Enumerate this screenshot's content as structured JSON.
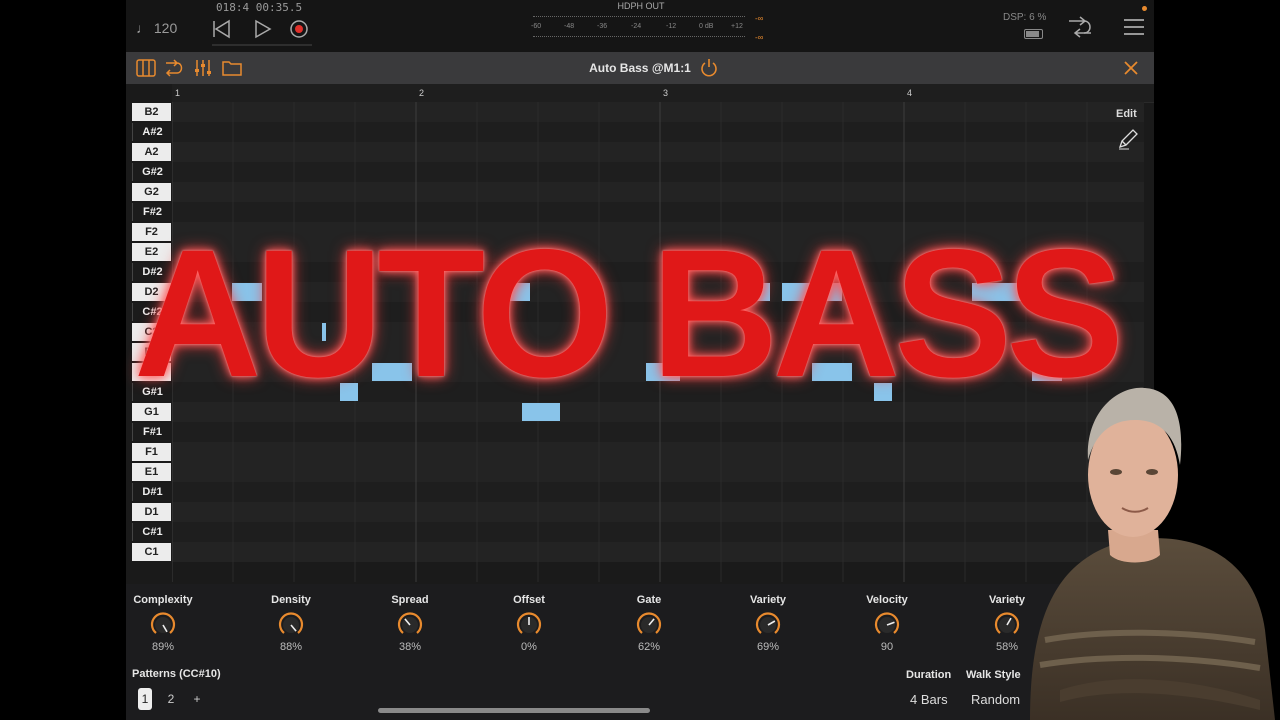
{
  "transport": {
    "tempo": "♩ 120",
    "position": "018:4   00:35.5",
    "meter_label": "HDPH OUT",
    "meter_ticks": [
      "-60",
      "-48",
      "-36",
      "-24",
      "-12",
      "0 dB",
      "+12"
    ],
    "meter_peak": "-∞",
    "dsp": "DSP: 6 %"
  },
  "plugin": {
    "title": "Auto Bass @M1:1"
  },
  "ruler": [
    "1",
    "2",
    "3",
    "4"
  ],
  "keys": [
    "B2",
    "A#2",
    "A2",
    "G#2",
    "G2",
    "F#2",
    "F2",
    "E2",
    "D#2",
    "D2",
    "C#2",
    "C2",
    "B1",
    "A1",
    "G#1",
    "G1",
    "F#1",
    "F1",
    "E1",
    "D#1",
    "D1",
    "C#1",
    "C1"
  ],
  "edit_label": "Edit",
  "knobs": [
    {
      "label": "Complexity",
      "value": "89%"
    },
    {
      "label": "Density",
      "value": "88%"
    },
    {
      "label": "Spread",
      "value": "38%"
    },
    {
      "label": "Offset",
      "value": "0%"
    },
    {
      "label": "Gate",
      "value": "62%"
    },
    {
      "label": "Variety",
      "value": "69%"
    },
    {
      "label": "Velocity",
      "value": "90"
    },
    {
      "label": "Variety",
      "value": "58%"
    }
  ],
  "patterns": {
    "label": "Patterns (CC#10)",
    "tabs": [
      "1",
      "2",
      "+"
    ]
  },
  "duration": {
    "label": "Duration",
    "value": "4 Bars"
  },
  "walk_style": {
    "label": "Walk Style",
    "value": "Random"
  },
  "overlay": {
    "title": "AUTO BASS"
  },
  "colors": {
    "accent": "#e88a2e",
    "note": "#89c4ea",
    "overlay": "#e01818"
  }
}
